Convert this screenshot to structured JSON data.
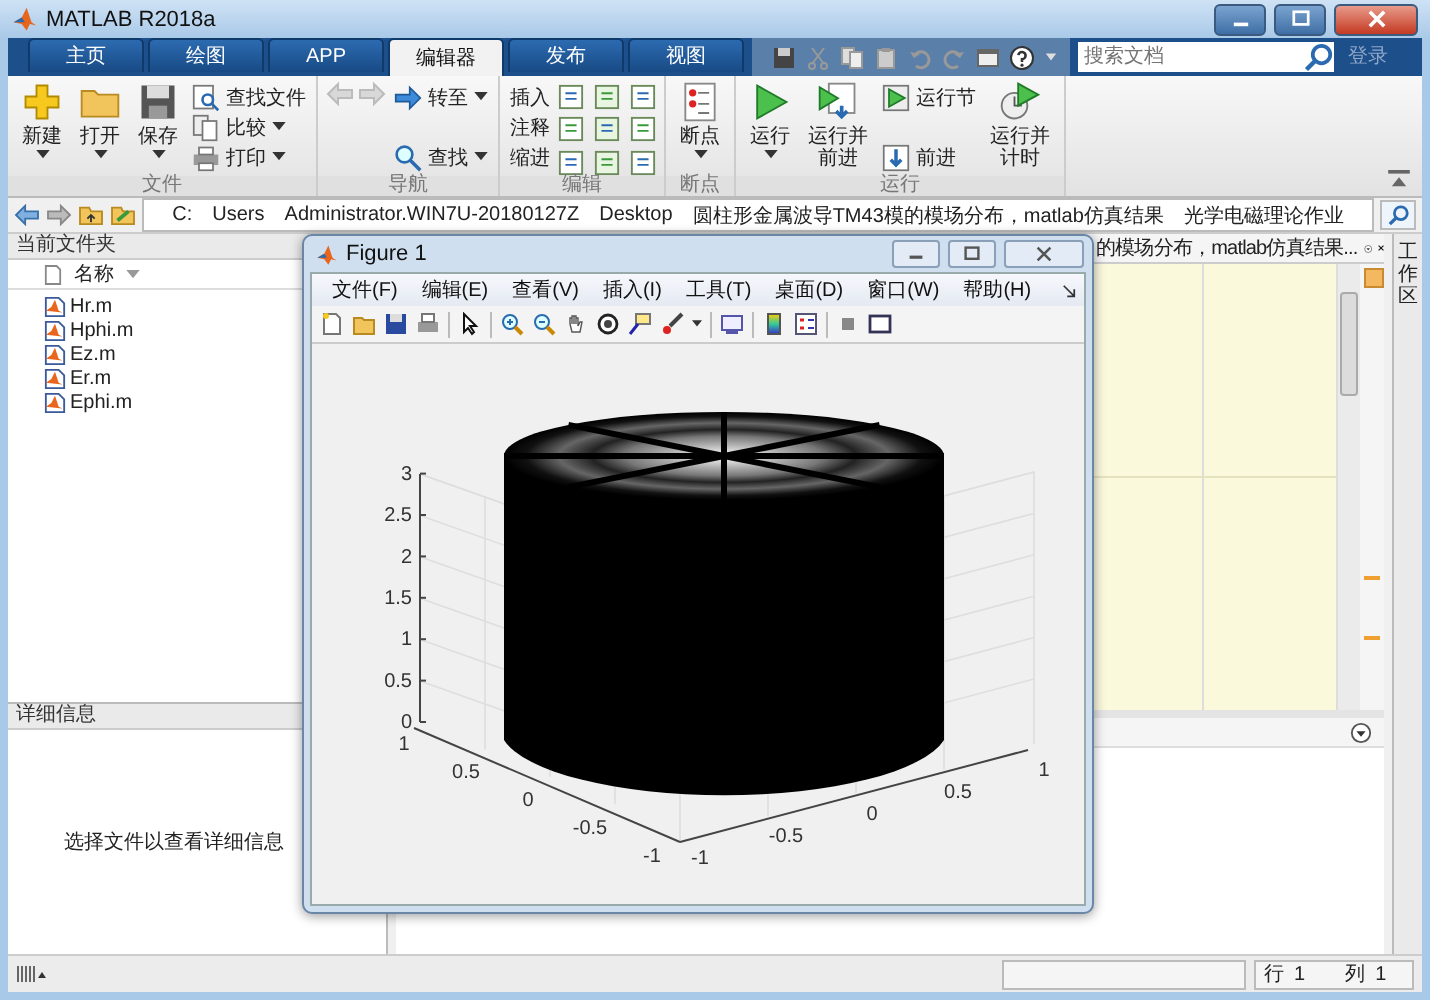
{
  "window": {
    "title": "MATLAB R2018a"
  },
  "ribbon_tabs": [
    {
      "label": "主页",
      "selected": false
    },
    {
      "label": "绘图",
      "selected": false
    },
    {
      "label": "APP",
      "selected": false
    },
    {
      "label": "编辑器",
      "selected": true
    },
    {
      "label": "发布",
      "selected": false
    },
    {
      "label": "视图",
      "selected": false
    }
  ],
  "search": {
    "placeholder": "搜索文档"
  },
  "login": "登录",
  "ribbon_groups": [
    {
      "label": "文件",
      "kind": "standard",
      "items": [
        {
          "kind": "large",
          "label": "新建",
          "dropdown": true
        },
        {
          "kind": "large",
          "label": "打开",
          "dropdown": true
        },
        {
          "kind": "large",
          "label": "保存",
          "dropdown": true
        },
        {
          "kind": "small",
          "label": "查找文件",
          "dropdown": false
        },
        {
          "kind": "small",
          "label": "比较",
          "dropdown": true
        },
        {
          "kind": "small",
          "label": "打印",
          "dropdown": true
        }
      ]
    },
    {
      "label": "导航",
      "kind": "navigation",
      "items": [
        {
          "kind": "small",
          "label": "转至",
          "dropdown": true
        },
        {
          "kind": "small",
          "label": "查找",
          "dropdown": true
        }
      ]
    },
    {
      "label": "编辑",
      "kind": "edit",
      "items": [
        {
          "kind": "label",
          "label": "插入"
        },
        {
          "kind": "label",
          "label": "注释"
        },
        {
          "kind": "label",
          "label": "缩进"
        }
      ]
    },
    {
      "label": "断点",
      "kind": "standard",
      "items": [
        {
          "kind": "large",
          "label": "断点",
          "dropdown": true
        }
      ]
    },
    {
      "label": "运行",
      "kind": "standard",
      "items": [
        {
          "kind": "large",
          "label": "运行",
          "dropdown": true
        },
        {
          "kind": "large",
          "label": "运行并前进",
          "dropdown": false
        },
        {
          "kind": "small",
          "label": "运行节",
          "dropdown": false
        },
        {
          "kind": "small",
          "label": "前进",
          "dropdown": false
        },
        {
          "kind": "large",
          "label": "运行并计时",
          "dropdown": false
        }
      ]
    }
  ],
  "address_bar": {
    "path": [
      "C:",
      "Users",
      "Administrator.WIN7U-20180127Z",
      "Desktop",
      "圆柱形金属波导TM43模的模场分布，matlab仿真结果",
      "光学电磁理论作业"
    ]
  },
  "current_folder": {
    "title": "当前文件夹",
    "column": "名称",
    "files": [
      "Hr.m",
      "Hphi.m",
      "Ez.m",
      "Er.m",
      "Ephi.m"
    ]
  },
  "details": {
    "title": "详细信息",
    "message": "选择文件以查看详细信息"
  },
  "editor": {
    "tab_label": "的模场分布，matlab仿真结果..."
  },
  "workspace_strip": {
    "label": "工作区"
  },
  "figure": {
    "title": "Figure 1",
    "menu": [
      "文件(F)",
      "编辑(E)",
      "查看(V)",
      "插入(I)",
      "工具(T)",
      "桌面(D)",
      "窗口(W)",
      "帮助(H)"
    ],
    "z_ticks": [
      "3",
      "2.5",
      "2",
      "1.5",
      "1",
      "0.5",
      "0"
    ],
    "y_ticks": [
      "1",
      "0.5",
      "0",
      "-0.5",
      "-1"
    ],
    "x_ticks": [
      "-1",
      "-0.5",
      "0",
      "0.5",
      "1"
    ]
  },
  "status_bar": {
    "row_label": "行",
    "row": "1",
    "column_label": "列",
    "column": "1"
  }
}
